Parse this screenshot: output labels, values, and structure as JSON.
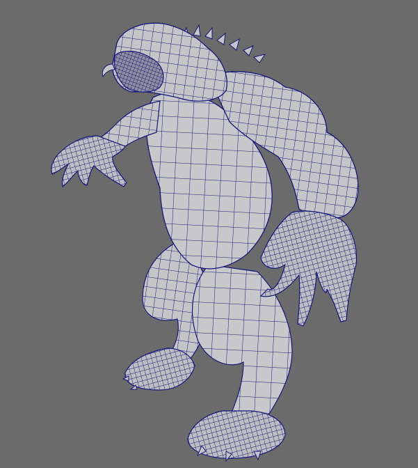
{
  "viewport": {
    "background_color": "#6b6b6b",
    "mesh_fill_color": "#c5c5c8",
    "mesh_shade_color": "#a9a9ae",
    "wire_color": "#16167a",
    "object": "wireframe-creature-model"
  }
}
